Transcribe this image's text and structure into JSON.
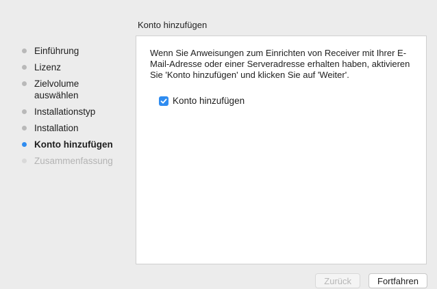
{
  "header": {
    "section_title": "Konto hinzufügen"
  },
  "sidebar": {
    "steps": [
      {
        "label": "Einführung",
        "state": "done"
      },
      {
        "label": "Lizenz",
        "state": "done"
      },
      {
        "label": "Zielvolume auswählen",
        "state": "done"
      },
      {
        "label": "Installationstyp",
        "state": "done"
      },
      {
        "label": "Installation",
        "state": "done"
      },
      {
        "label": "Konto hinzufügen",
        "state": "active"
      },
      {
        "label": "Zusammenfassung",
        "state": "pending"
      }
    ]
  },
  "content": {
    "description": "Wenn Sie Anweisungen zum Einrichten von Receiver mit Ihrer E-Mail-Adresse oder einer Serveradresse erhalten haben, aktivieren Sie 'Konto hinzufügen' und klicken Sie auf 'Weiter'.",
    "checkbox": {
      "label": "Konto hinzufügen",
      "checked": true
    }
  },
  "footer": {
    "back_label": "Zurück",
    "continue_label": "Fortfahren"
  },
  "colors": {
    "accent": "#2f8cf0",
    "background": "#ececec",
    "panel": "#ffffff"
  }
}
